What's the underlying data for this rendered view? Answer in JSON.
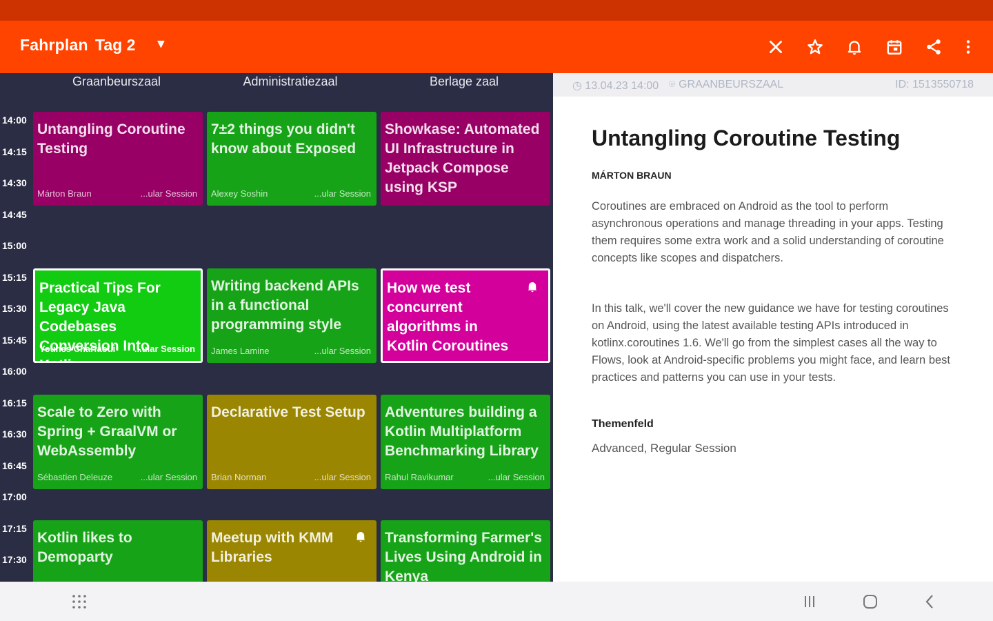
{
  "toolbar": {
    "title": "Fahrplan",
    "day": "Tag 2",
    "icons": [
      "close-icon",
      "star-icon",
      "bell-icon",
      "calendar-icon",
      "share-icon",
      "more-vert-icon"
    ]
  },
  "schedule": {
    "rooms": [
      "Graanbeurszaal",
      "Administratiezaal",
      "Berlage zaal"
    ],
    "times": [
      "14:00",
      "14:15",
      "14:30",
      "14:45",
      "15:00",
      "15:15",
      "15:30",
      "15:45",
      "16:00",
      "16:15",
      "16:30",
      "16:45",
      "17:00",
      "17:15",
      "17:30"
    ],
    "events": [
      {
        "title": "Untangling Coroutine Testing",
        "speaker": "Márton Braun",
        "track": "...ular Session",
        "color": "#990066"
      },
      {
        "title": "7±2 things you didn't know about Exposed",
        "speaker": "Alexey Soshin",
        "track": "...ular Session",
        "color": "#17a317"
      },
      {
        "title": "Showkase: Automated UI Infrastructure in Jetpack Compose using KSP",
        "speaker": "",
        "track": "",
        "color": "#990066"
      },
      {
        "title": "Practical Tips For Legacy Java Codebases Conversion Into Kotlin",
        "speaker": "Younes Charfaoui",
        "track": "...ular Session",
        "color": "#11cc11"
      },
      {
        "title": "Writing backend APIs in a functional programming style",
        "speaker": "James Lamine",
        "track": "...ular Session",
        "color": "#17a317"
      },
      {
        "title": "How we test concurrent algorithms in Kotlin Coroutines",
        "speaker": "",
        "track": "",
        "color": "#d4009c"
      },
      {
        "title": "Scale to Zero with Spring + GraalVM or WebAssembly",
        "speaker": "Sébastien Deleuze",
        "track": "...ular Session",
        "color": "#17a317"
      },
      {
        "title": "Declarative Test Setup",
        "speaker": "Brian Norman",
        "track": "...ular Session",
        "color": "#9a8600"
      },
      {
        "title": "Adventures building a Kotlin Multiplatform Benchmarking Library",
        "speaker": "Rahul Ravikumar",
        "track": "...ular Session",
        "color": "#17a317"
      },
      {
        "title": "Kotlin likes to Demoparty",
        "speaker": "",
        "track": "",
        "color": "#17a317"
      },
      {
        "title": "Meetup with KMM Libraries",
        "speaker": "",
        "track": "",
        "color": "#9a8600"
      },
      {
        "title": "Transforming Farmer's Lives Using Android in Kenya",
        "speaker": "",
        "track": "",
        "color": "#17a317"
      }
    ]
  },
  "detail": {
    "date": "13.04.23 14:00",
    "room": "GRAANBEURSZAAL",
    "id": "ID: 1513550718",
    "title": "Untangling Coroutine Testing",
    "speaker": "MÁRTON BRAUN",
    "paragraph1": "Coroutines are embraced on Android as the tool to perform asynchronous operations and manage threading in your apps. Testing them requires some extra work and a solid understanding of coroutine concepts like scopes and dispatchers.",
    "paragraph2": "In this talk, we'll cover the new guidance we have for testing coroutines on Android, using the latest available testing APIs introduced in kotlinx.coroutines 1.6. We'll go from the simplest cases all the way to Flows, look at Android-specific problems you might face, and learn best practices and patterns you can use in your tests.",
    "field_label": "Themenfeld",
    "field_value": "Advanced, Regular Session"
  },
  "navbar": {
    "icons": [
      "apps-grid-icon",
      "recents-icon",
      "home-icon",
      "back-icon"
    ]
  }
}
